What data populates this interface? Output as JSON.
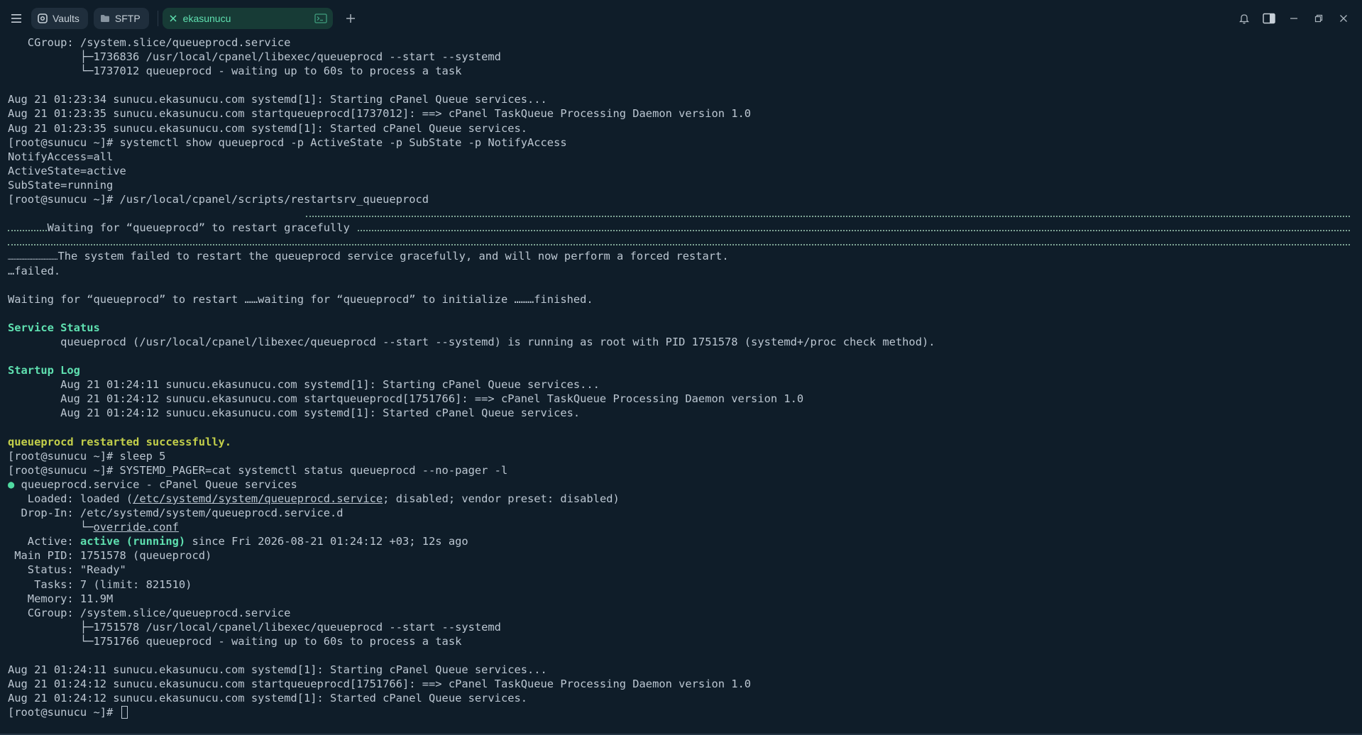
{
  "tabbar": {
    "vaults_label": "Vaults",
    "sftp_label": "SFTP",
    "active_tab_label": "ekasunucu"
  },
  "colors": {
    "background": "#0f1d29",
    "accent": "#5fe0b0",
    "text": "#bcc7d2",
    "success_text": "#c3cf4a"
  },
  "icons": {
    "menu": "hamburger-menu-icon",
    "vaults": "vault-icon",
    "sftp": "folder-icon",
    "close_tab": "close-icon",
    "terminal": "terminal-icon",
    "add_tab": "plus-icon",
    "notifications": "bell-icon",
    "panel": "side-panel-icon",
    "minimize": "minimize-icon",
    "restore": "restore-icon",
    "close_window": "close-window-icon"
  },
  "terminal": {
    "l1_key": "   CGroup: ",
    "l1_val": "/system.slice/queueprocd.service",
    "l2": "           ├─1736836 /usr/local/cpanel/libexec/queueprocd --start --systemd",
    "l3": "           └─1737012 queueprocd - waiting up to 60s to process a task",
    "l4": "",
    "l5": "Aug 21 01:23:34 sunucu.ekasunucu.com systemd[1]: Starting cPanel Queue services...",
    "l6": "Aug 21 01:23:35 sunucu.ekasunucu.com startqueueprocd[1737012]: ==> cPanel TaskQueue Processing Daemon version 1.0",
    "l7": "Aug 21 01:23:35 sunucu.ekasunucu.com systemd[1]: Started cPanel Queue services.",
    "l8": "[root@sunucu ~]# systemctl show queueprocd -p ActiveState -p SubState -p NotifyAccess",
    "l9": "NotifyAccess=all",
    "l10": "ActiveState=active",
    "l11": "SubState=running",
    "l12": "[root@sunucu ~]# /usr/local/cpanel/scripts/restartsrv_queueprocd",
    "l13": "Waiting for “queueprocd” to restart gracefully ",
    "l16_dots": "…………………………………",
    "l16_text": "The system failed to restart the queueprocd service gracefully, and will now perform a forced restart.",
    "l17": "…failed.",
    "l18": "",
    "l19": "Waiting for “queueprocd” to restart ……waiting for “queueprocd” to initialize ………finished.",
    "l20": "",
    "l21": "Service Status",
    "l22": "        queueprocd (/usr/local/cpanel/libexec/queueprocd --start --systemd) is running as root with PID 1751578 (systemd+/proc check method).",
    "l23": "",
    "l24": "Startup Log",
    "l25": "        Aug 21 01:24:11 sunucu.ekasunucu.com systemd[1]: Starting cPanel Queue services...",
    "l26": "        Aug 21 01:24:12 sunucu.ekasunucu.com startqueueprocd[1751766]: ==> cPanel TaskQueue Processing Daemon version 1.0",
    "l27": "        Aug 21 01:24:12 sunucu.ekasunucu.com systemd[1]: Started cPanel Queue services.",
    "l28": "",
    "l29": "queueprocd restarted successfully.",
    "l30": "[root@sunucu ~]# sleep 5",
    "l31": "[root@sunucu ~]# SYSTEMD_PAGER=cat systemctl status queueprocd --no-pager -l",
    "l32_dot": "●",
    "l32_text": " queueprocd.service - cPanel Queue services",
    "l33_a": "   Loaded: loaded (",
    "l33_link": "/etc/systemd/system/queueprocd.service",
    "l33_b": "; disabled; vendor preset: disabled)",
    "l34": "  Drop-In: /etc/systemd/system/queueprocd.service.d",
    "l35_a": "           └─",
    "l35_link": "override.conf",
    "l36_a": "   Active: ",
    "l36_state": "active (running)",
    "l36_b": " since Fri 2026-08-21 01:24:12 +03; 12s ago",
    "l37": " Main PID: 1751578 (queueprocd)",
    "l38": "   Status: \"Ready\"",
    "l39": "    Tasks: 7 (limit: 821510)",
    "l40": "   Memory: 11.9M",
    "l41": "   CGroup: /system.slice/queueprocd.service",
    "l42": "           ├─1751578 /usr/local/cpanel/libexec/queueprocd --start --systemd",
    "l43": "           └─1751766 queueprocd - waiting up to 60s to process a task",
    "l44": "",
    "l45": "Aug 21 01:24:11 sunucu.ekasunucu.com systemd[1]: Starting cPanel Queue services...",
    "l46": "Aug 21 01:24:12 sunucu.ekasunucu.com startqueueprocd[1751766]: ==> cPanel TaskQueue Processing Daemon version 1.0",
    "l47": "Aug 21 01:24:12 sunucu.ekasunucu.com systemd[1]: Started cPanel Queue services.",
    "l48": "[root@sunucu ~]# "
  }
}
